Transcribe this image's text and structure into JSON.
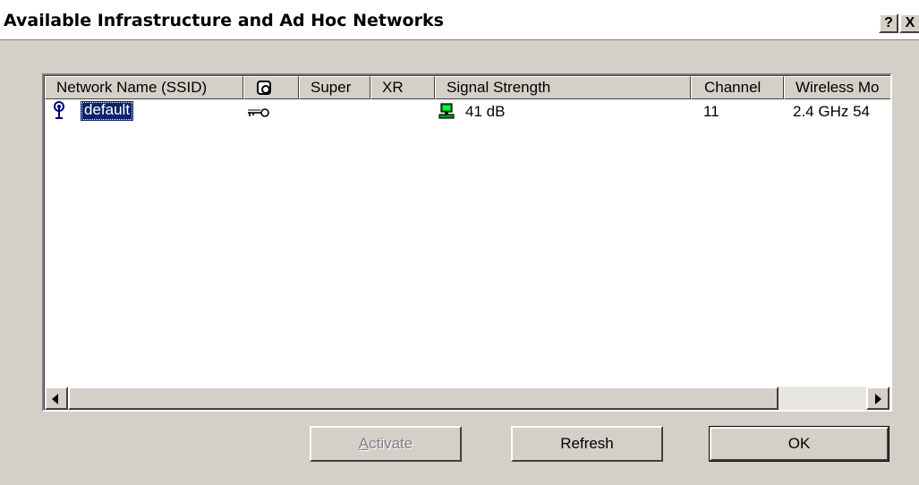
{
  "window": {
    "title": "Available Infrastructure and Ad Hoc Networks",
    "help_label": "?",
    "close_label": "X"
  },
  "table": {
    "columns": [
      "Network Name (SSID)",
      "",
      "Super",
      "XR",
      "Signal Strength",
      "Channel",
      "Wireless Mo"
    ],
    "security_column_icon": "lock-icon",
    "rows": [
      {
        "ssid": "default",
        "ssid_icon": "access-point-icon",
        "security_icon": "key-icon",
        "super": "",
        "xr": "",
        "signal_icon": "signal-computer-icon",
        "signal": "41 dB",
        "channel": "11",
        "wireless_mode": "2.4 GHz 54"
      }
    ]
  },
  "buttons": {
    "activate_first": "A",
    "activate_rest": "ctivate",
    "refresh": "Refresh",
    "ok": "OK"
  },
  "colors": {
    "dialog_bg": "#d4d0c8",
    "selection_bg": "#0a246a",
    "signal_green": "#00a000"
  }
}
